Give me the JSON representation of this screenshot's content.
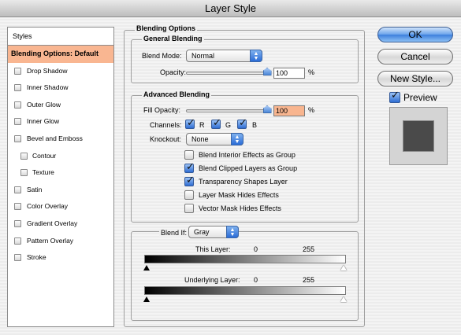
{
  "window": {
    "title": "Layer Style"
  },
  "styles_panel": {
    "header": "Styles",
    "items": [
      {
        "label": "Blending Options: Default",
        "selected": true,
        "checkbox": false,
        "sub": false
      },
      {
        "label": "Drop Shadow",
        "checkbox": true,
        "sub": false
      },
      {
        "label": "Inner Shadow",
        "checkbox": true,
        "sub": false
      },
      {
        "label": "Outer Glow",
        "checkbox": true,
        "sub": false
      },
      {
        "label": "Inner Glow",
        "checkbox": true,
        "sub": false
      },
      {
        "label": "Bevel and Emboss",
        "checkbox": true,
        "sub": false
      },
      {
        "label": "Contour",
        "checkbox": true,
        "sub": true
      },
      {
        "label": "Texture",
        "checkbox": true,
        "sub": true
      },
      {
        "label": "Satin",
        "checkbox": true,
        "sub": false
      },
      {
        "label": "Color Overlay",
        "checkbox": true,
        "sub": false
      },
      {
        "label": "Gradient Overlay",
        "checkbox": true,
        "sub": false
      },
      {
        "label": "Pattern Overlay",
        "checkbox": true,
        "sub": false
      },
      {
        "label": "Stroke",
        "checkbox": true,
        "sub": false
      }
    ]
  },
  "blending_options": {
    "title": "Blending Options",
    "general": {
      "title": "General Blending",
      "blend_mode_label": "Blend Mode:",
      "blend_mode_value": "Normal",
      "opacity_label": "Opacity:",
      "opacity_value": "100",
      "opacity_unit": "%",
      "opacity_level": 1.0
    },
    "advanced": {
      "title": "Advanced Blending",
      "fill_opacity_label": "Fill Opacity:",
      "fill_opacity_value": "100",
      "fill_opacity_unit": "%",
      "fill_opacity_level": 1.0,
      "channels_label": "Channels:",
      "channels": [
        {
          "label": "R",
          "checked": true
        },
        {
          "label": "G",
          "checked": true
        },
        {
          "label": "B",
          "checked": true
        }
      ],
      "knockout_label": "Knockout:",
      "knockout_value": "None",
      "options": [
        {
          "label": "Blend Interior Effects as Group",
          "checked": false
        },
        {
          "label": "Blend Clipped Layers as Group",
          "checked": true
        },
        {
          "label": "Transparency Shapes Layer",
          "checked": true
        },
        {
          "label": "Layer Mask Hides Effects",
          "checked": false
        },
        {
          "label": "Vector Mask Hides Effects",
          "checked": false
        }
      ]
    },
    "blend_if": {
      "label": "Blend If:",
      "value": "Gray",
      "this_layer_label": "This Layer:",
      "this_layer_min": "0",
      "this_layer_max": "255",
      "underlying_label": "Underlying Layer:",
      "underlying_min": "0",
      "underlying_max": "255"
    }
  },
  "buttons": {
    "ok": "OK",
    "cancel": "Cancel",
    "new_style": "New Style..."
  },
  "preview": {
    "label": "Preview",
    "checked": true
  },
  "colors": {
    "selection": "#f9b691",
    "accent": "#3c7fdc"
  }
}
